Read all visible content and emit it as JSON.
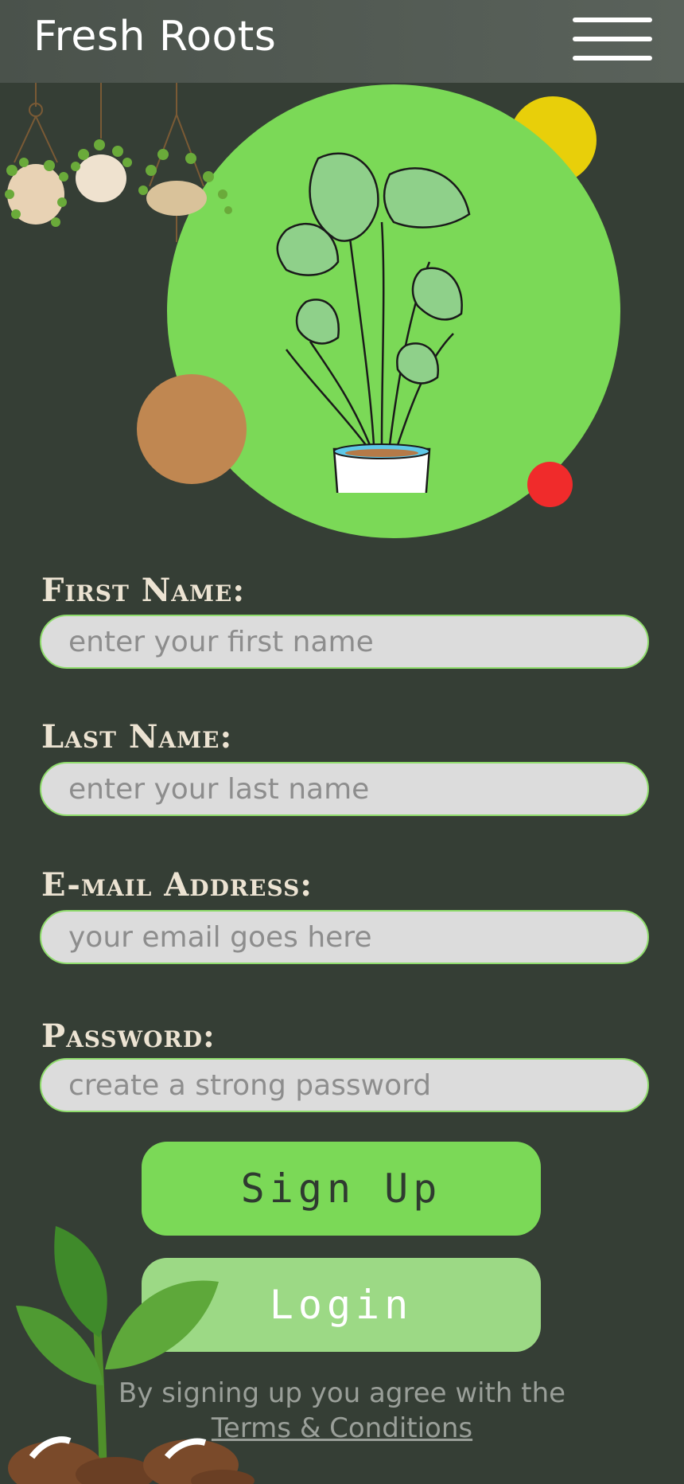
{
  "header": {
    "brand": "Fresh Roots",
    "menu_icon": "hamburger-menu-icon"
  },
  "colors": {
    "background": "#353e35",
    "accent_green": "#7bd957",
    "light_green": "#9cd985",
    "yellow": "#e8cf0a",
    "brown": "#c08751",
    "red": "#f02b2b",
    "label": "#ece3d2"
  },
  "form": {
    "first_name": {
      "label": "First Name:",
      "placeholder": "enter your first name",
      "value": ""
    },
    "last_name": {
      "label": "Last Name:",
      "placeholder": "enter your last name",
      "value": ""
    },
    "email": {
      "label": "E-mail Address:",
      "placeholder": "your email goes here",
      "value": ""
    },
    "password": {
      "label": "Password:",
      "placeholder": "create a strong password",
      "value": ""
    }
  },
  "buttons": {
    "signup": "Sign Up",
    "login": "Login"
  },
  "terms": {
    "text": "By signing up you agree with the",
    "link": "Terms & Conditions"
  }
}
